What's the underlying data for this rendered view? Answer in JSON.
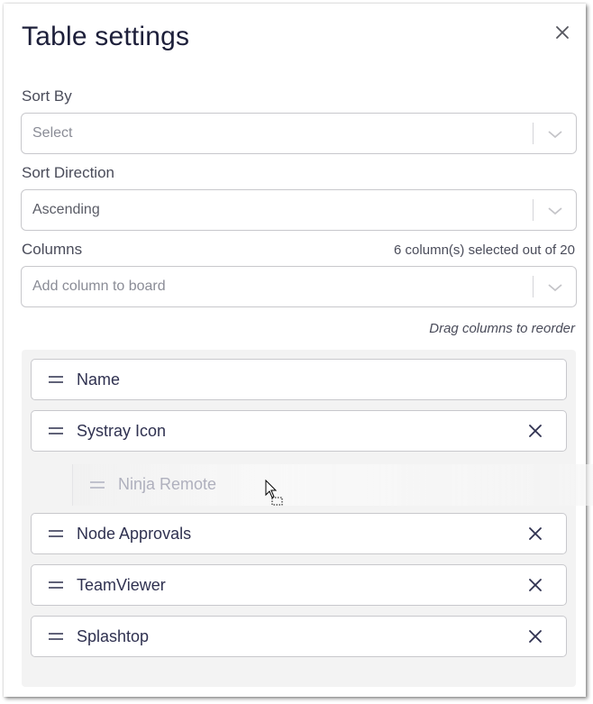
{
  "dialog": {
    "title": "Table settings",
    "close_icon": "close-icon"
  },
  "sort_by": {
    "label": "Sort By",
    "placeholder": "Select",
    "value": null
  },
  "sort_direction": {
    "label": "Sort Direction",
    "value": "Ascending"
  },
  "columns": {
    "label": "Columns",
    "count_text": "6 column(s) selected out of 20",
    "selected_count": 6,
    "total_count": 20,
    "add_placeholder": "Add column to board",
    "hint": "Drag columns to reorder",
    "items": [
      {
        "label": "Name",
        "removable": false
      },
      {
        "label": "Systray Icon",
        "removable": true
      },
      {
        "label": "Ninja Remote",
        "removable": true,
        "dragging": true
      },
      {
        "label": "Node Approvals",
        "removable": true
      },
      {
        "label": "TeamViewer",
        "removable": true
      },
      {
        "label": "Splashtop",
        "removable": true
      }
    ]
  },
  "icons": {
    "drag_handle": "drag-handle-icon",
    "remove": "remove-icon",
    "chevron": "chevron-down-icon",
    "cursor": "drag-cursor-icon"
  },
  "colors": {
    "text_primary": "#1d1f3a",
    "item_text": "#2f3150",
    "label_text": "#4a4c5a",
    "border": "#c8c8cc",
    "list_bg": "#f3f3f3"
  }
}
